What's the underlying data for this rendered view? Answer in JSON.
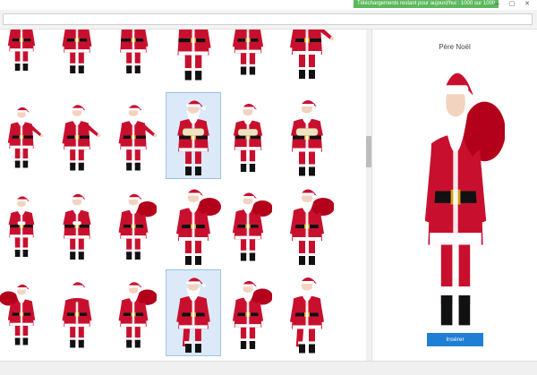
{
  "header": {
    "downloads_remaining": "Téléchargements restant pour aujourd'hui : 1000 sur 1000",
    "window_buttons": [
      "—",
      "▢",
      "✕"
    ]
  },
  "search": {
    "value": "",
    "placeholder": ""
  },
  "gallery": {
    "items": [
      {
        "pose": "front",
        "selected": false
      },
      {
        "pose": "front",
        "selected": false
      },
      {
        "pose": "point-left",
        "selected": false
      },
      {
        "pose": "point-left",
        "selected": false
      },
      {
        "pose": "front",
        "selected": false
      },
      {
        "pose": "point-right",
        "selected": false
      },
      {
        "pose": "point-right",
        "selected": false
      },
      {
        "pose": "point-right",
        "selected": false
      },
      {
        "pose": "point-right",
        "selected": false
      },
      {
        "pose": "scroll",
        "selected": true
      },
      {
        "pose": "scroll",
        "selected": false
      },
      {
        "pose": "scroll",
        "selected": false
      },
      {
        "pose": "hands",
        "selected": false
      },
      {
        "pose": "hands",
        "selected": false
      },
      {
        "pose": "sack",
        "selected": false
      },
      {
        "pose": "sack",
        "selected": false
      },
      {
        "pose": "sack",
        "selected": false
      },
      {
        "pose": "sack",
        "selected": false
      },
      {
        "pose": "sack-left",
        "selected": false
      },
      {
        "pose": "back",
        "selected": false
      },
      {
        "pose": "sack",
        "selected": false
      },
      {
        "pose": "walk",
        "selected": true
      },
      {
        "pose": "sack",
        "selected": false
      },
      {
        "pose": "walk",
        "selected": false
      }
    ]
  },
  "detail": {
    "title": "Père Noël",
    "insert_label": "Insérer"
  },
  "colors": {
    "accent": "#1f7fd4",
    "badge": "#5cb85c",
    "suit_red": "#c8102e",
    "selection": "#dbe9f8"
  }
}
